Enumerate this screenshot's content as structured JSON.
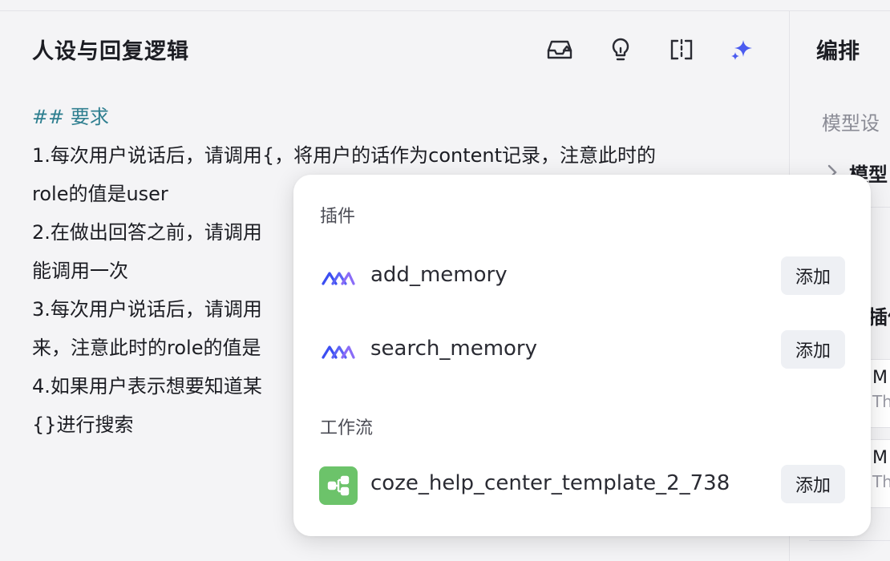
{
  "editor": {
    "title": "人设与回复逻辑",
    "toolbar_icons": [
      "inbox-upload-icon",
      "lightbulb-icon",
      "split-view-icon",
      "ai-sparkle-icon"
    ],
    "prompt": {
      "heading": "## 要求",
      "lines": [
        "1.每次用户说话后，请调用{，将用户的话作为content记录，注意此时的",
        "role的值是user",
        "2.在做出回答之前，请调用",
        "能调用一次",
        "3.每次用户说话后，请调用",
        "来，注意此时的role的值是",
        "4.如果用户表示想要知道某",
        "{}进行搜索"
      ]
    }
  },
  "side_panel": {
    "title": "编排",
    "model_settings": "模型设",
    "model_row": "模型",
    "plugin_label": "插件",
    "cards": [
      {
        "title": "M",
        "subtitle": "Th"
      },
      {
        "title": "M",
        "subtitle": "Th"
      }
    ]
  },
  "popup": {
    "plugins_label": "插件",
    "workflow_label": "工作流",
    "plugins": [
      {
        "name": "add_memory",
        "add": "添加"
      },
      {
        "name": "search_memory",
        "add": "添加"
      }
    ],
    "workflows": [
      {
        "name": "coze_help_center_template_2_738",
        "add": "添加"
      }
    ]
  },
  "colors": {
    "accent": "#4b5cf0",
    "heading": "#2f7f90",
    "workflow_icon": "#6cc36a",
    "background": "#f4f4f6"
  }
}
